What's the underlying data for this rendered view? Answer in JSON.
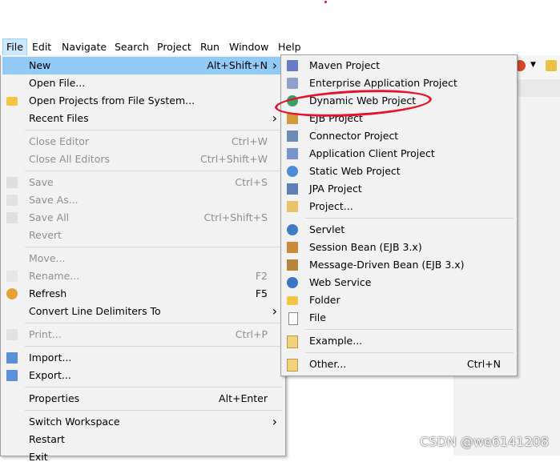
{
  "menubar": [
    "File",
    "Edit",
    "Navigate",
    "Search",
    "Project",
    "Run",
    "Window",
    "Help"
  ],
  "file_menu": [
    {
      "label": "New",
      "accel": "Alt+Shift+N",
      "arrow": true,
      "hl": true,
      "icon": "none"
    },
    {
      "label": "Open File...",
      "icon": "none"
    },
    {
      "label": "Open Projects from File System...",
      "icon": "folder-icon"
    },
    {
      "label": "Recent Files",
      "arrow": true,
      "icon": "none"
    },
    {
      "sep": true
    },
    {
      "label": "Close Editor",
      "accel": "Ctrl+W",
      "disabled": true,
      "icon": "none"
    },
    {
      "label": "Close All Editors",
      "accel": "Ctrl+Shift+W",
      "disabled": true,
      "icon": "none"
    },
    {
      "sep": true
    },
    {
      "label": "Save",
      "accel": "Ctrl+S",
      "disabled": true,
      "icon": "save-icon"
    },
    {
      "label": "Save As...",
      "disabled": true,
      "icon": "save-as-icon"
    },
    {
      "label": "Save All",
      "accel": "Ctrl+Shift+S",
      "disabled": true,
      "icon": "save-all-icon"
    },
    {
      "label": "Revert",
      "disabled": true,
      "icon": "none"
    },
    {
      "sep": true
    },
    {
      "label": "Move...",
      "disabled": true,
      "icon": "none"
    },
    {
      "label": "Rename...",
      "accel": "F2",
      "disabled": true,
      "icon": "rename-icon"
    },
    {
      "label": "Refresh",
      "accel": "F5",
      "icon": "refresh-icon"
    },
    {
      "label": "Convert Line Delimiters To",
      "arrow": true,
      "icon": "none"
    },
    {
      "sep": true
    },
    {
      "label": "Print...",
      "accel": "Ctrl+P",
      "disabled": true,
      "icon": "print-icon"
    },
    {
      "sep": true
    },
    {
      "label": "Import...",
      "icon": "import-icon"
    },
    {
      "label": "Export...",
      "icon": "export-icon"
    },
    {
      "sep": true
    },
    {
      "label": "Properties",
      "accel": "Alt+Enter",
      "icon": "none"
    },
    {
      "sep": true
    },
    {
      "label": "Switch Workspace",
      "arrow": true,
      "icon": "none"
    },
    {
      "label": "Restart",
      "icon": "none"
    },
    {
      "label": "Exit",
      "icon": "none"
    }
  ],
  "new_menu": [
    {
      "label": "Maven Project",
      "icon": "maven-icon"
    },
    {
      "label": "Enterprise Application Project",
      "icon": "ear-project-icon"
    },
    {
      "label": "Dynamic Web Project",
      "icon": "web-project-icon"
    },
    {
      "label": "EJB Project",
      "icon": "ejb-project-icon"
    },
    {
      "label": "Connector Project",
      "icon": "connector-icon"
    },
    {
      "label": "Application Client Project",
      "icon": "app-client-icon"
    },
    {
      "label": "Static Web Project",
      "icon": "static-web-icon"
    },
    {
      "label": "JPA Project",
      "icon": "jpa-icon"
    },
    {
      "label": "Project...",
      "icon": "project-icon"
    },
    {
      "sep": true
    },
    {
      "label": "Servlet",
      "icon": "servlet-icon"
    },
    {
      "label": "Session Bean (EJB 3.x)",
      "icon": "session-bean-icon"
    },
    {
      "label": "Message-Driven Bean (EJB 3.x)",
      "icon": "mdb-icon"
    },
    {
      "label": "Web Service",
      "icon": "web-service-icon"
    },
    {
      "label": "Folder",
      "icon": "folder-icon"
    },
    {
      "label": "File",
      "icon": "file-icon"
    },
    {
      "sep": true
    },
    {
      "label": "Example...",
      "icon": "example-icon"
    },
    {
      "sep": true
    },
    {
      "label": "Other...",
      "accel": "Ctrl+N",
      "icon": "other-icon"
    }
  ],
  "colors": {
    "highlight": "#91c9f7",
    "annotation": "#e8102a"
  },
  "watermark": "CSDN @we6141208"
}
